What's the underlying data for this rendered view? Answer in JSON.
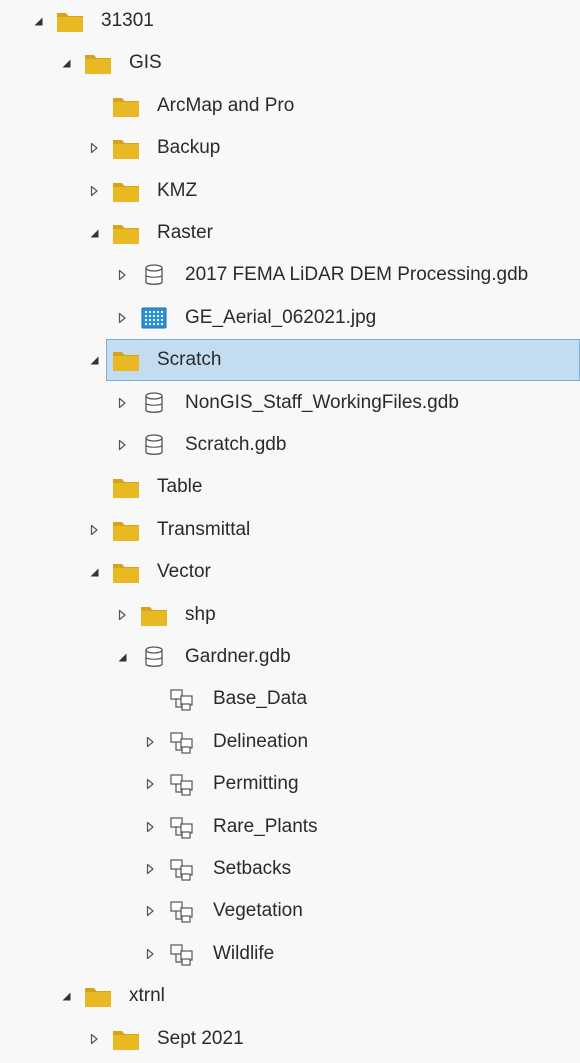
{
  "colors": {
    "folder": "#e8b923",
    "folder_tab": "#d6a31a",
    "selection_fill": "#c3dcef",
    "selection_border": "#7fb0d6",
    "text": "#2a2a2a",
    "background": "#f8f8f8"
  },
  "tree": [
    {
      "label": "31301",
      "icon": "folder-icon",
      "expander": "expanded",
      "level": 0
    },
    {
      "label": "GIS",
      "icon": "folder-icon",
      "expander": "expanded",
      "level": 1
    },
    {
      "label": "ArcMap and Pro",
      "icon": "folder-icon",
      "expander": "none",
      "level": 2
    },
    {
      "label": "Backup",
      "icon": "folder-icon",
      "expander": "collapsed",
      "level": 2
    },
    {
      "label": "KMZ",
      "icon": "folder-icon",
      "expander": "collapsed",
      "level": 2
    },
    {
      "label": "Raster",
      "icon": "folder-icon",
      "expander": "expanded",
      "level": 2
    },
    {
      "label": "2017 FEMA LiDAR DEM Processing.gdb",
      "icon": "geodatabase-icon",
      "expander": "collapsed",
      "level": 3
    },
    {
      "label": "GE_Aerial_062021.jpg",
      "icon": "raster-icon",
      "expander": "collapsed",
      "level": 3
    },
    {
      "label": "Scratch",
      "icon": "folder-icon",
      "expander": "expanded",
      "level": 2,
      "selected": true
    },
    {
      "label": "NonGIS_Staff_WorkingFiles.gdb",
      "icon": "geodatabase-icon",
      "expander": "collapsed",
      "level": 3
    },
    {
      "label": "Scratch.gdb",
      "icon": "geodatabase-icon",
      "expander": "collapsed",
      "level": 3
    },
    {
      "label": "Table",
      "icon": "folder-icon",
      "expander": "none",
      "level": 2
    },
    {
      "label": "Transmittal",
      "icon": "folder-icon",
      "expander": "collapsed",
      "level": 2
    },
    {
      "label": "Vector",
      "icon": "folder-icon",
      "expander": "expanded",
      "level": 2
    },
    {
      "label": "shp",
      "icon": "folder-icon",
      "expander": "collapsed",
      "level": 3
    },
    {
      "label": "Gardner.gdb",
      "icon": "geodatabase-icon",
      "expander": "expanded",
      "level": 3
    },
    {
      "label": "Base_Data",
      "icon": "feature-dataset-icon",
      "expander": "none",
      "level": 4
    },
    {
      "label": "Delineation",
      "icon": "feature-dataset-icon",
      "expander": "collapsed",
      "level": 4
    },
    {
      "label": "Permitting",
      "icon": "feature-dataset-icon",
      "expander": "collapsed",
      "level": 4
    },
    {
      "label": "Rare_Plants",
      "icon": "feature-dataset-icon",
      "expander": "collapsed",
      "level": 4
    },
    {
      "label": "Setbacks",
      "icon": "feature-dataset-icon",
      "expander": "collapsed",
      "level": 4
    },
    {
      "label": "Vegetation",
      "icon": "feature-dataset-icon",
      "expander": "collapsed",
      "level": 4
    },
    {
      "label": "Wildlife",
      "icon": "feature-dataset-icon",
      "expander": "collapsed",
      "level": 4
    },
    {
      "label": "xtrnl",
      "icon": "folder-icon",
      "expander": "expanded",
      "level": 1
    },
    {
      "label": "Sept 2021",
      "icon": "folder-icon",
      "expander": "collapsed",
      "level": 2
    }
  ]
}
